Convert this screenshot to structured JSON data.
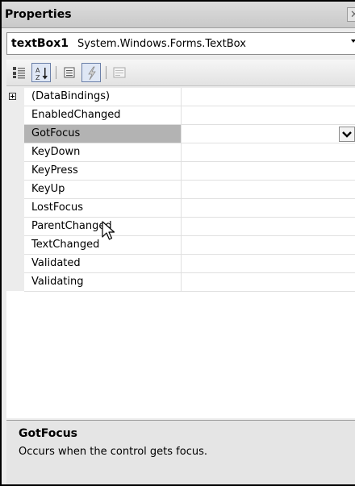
{
  "window": {
    "title": "Properties",
    "close_glyph": "✕"
  },
  "object_selector": {
    "name": "textBox1",
    "type": "System.Windows.Forms.TextBox"
  },
  "toolbar": {
    "buttons": [
      {
        "icon": "categorized-icon",
        "pressed": false
      },
      {
        "icon": "alphabetical-icon",
        "pressed": true
      },
      {
        "icon": "properties-icon",
        "pressed": false
      },
      {
        "icon": "events-icon",
        "pressed": true
      },
      {
        "icon": "property-pages-icon",
        "pressed": false
      }
    ]
  },
  "grid": {
    "rows": [
      {
        "name": "(DataBindings)",
        "expandable": true
      },
      {
        "name": "EnabledChanged"
      },
      {
        "name": "GotFocus",
        "selected": true
      },
      {
        "name": "KeyDown"
      },
      {
        "name": "KeyPress"
      },
      {
        "name": "KeyUp"
      },
      {
        "name": "LostFocus"
      },
      {
        "name": "ParentChanged"
      },
      {
        "name": "TextChanged"
      },
      {
        "name": "Validated"
      },
      {
        "name": "Validating"
      }
    ]
  },
  "description": {
    "title": "GotFocus",
    "text": "Occurs when the control gets focus."
  }
}
